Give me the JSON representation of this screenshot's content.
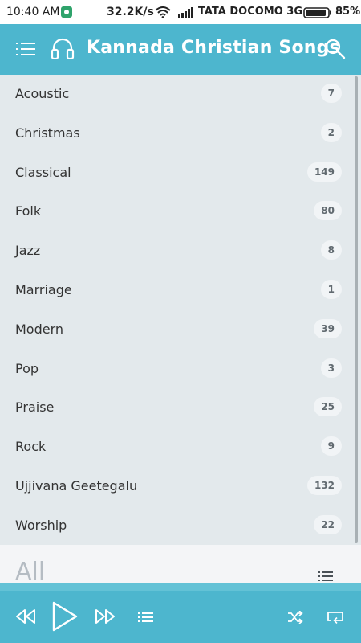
{
  "status_bar": {
    "time": "10:40 AM",
    "speed": "32.2K/s",
    "carrier": "TATA DOCOMO 3G",
    "battery": "85%"
  },
  "app_bar": {
    "title": "Kannada Christian Songs",
    "icons": [
      "menu-list-icon",
      "headphones-icon",
      "search-icon"
    ]
  },
  "genres": [
    {
      "name": "Acoustic",
      "count": "7"
    },
    {
      "name": "Christmas",
      "count": "2"
    },
    {
      "name": "Classical",
      "count": "149"
    },
    {
      "name": "Folk",
      "count": "80"
    },
    {
      "name": "Jazz",
      "count": "8"
    },
    {
      "name": "Marriage",
      "count": "1"
    },
    {
      "name": "Modern",
      "count": "39"
    },
    {
      "name": "Pop",
      "count": "3"
    },
    {
      "name": "Praise",
      "count": "25"
    },
    {
      "name": "Rock",
      "count": "9"
    },
    {
      "name": "Ujjivana Geetegalu",
      "count": "132"
    },
    {
      "name": "Worship",
      "count": "22"
    }
  ],
  "all_section": {
    "label": "All"
  },
  "player": {
    "icons": [
      "rewind-icon",
      "play-icon",
      "fast-forward-icon",
      "queue-icon",
      "shuffle-icon",
      "repeat-icon"
    ]
  },
  "colors": {
    "accent": "#4db6ce",
    "list_background": "#e3e9ec",
    "badge_background": "#f1f4f6"
  }
}
